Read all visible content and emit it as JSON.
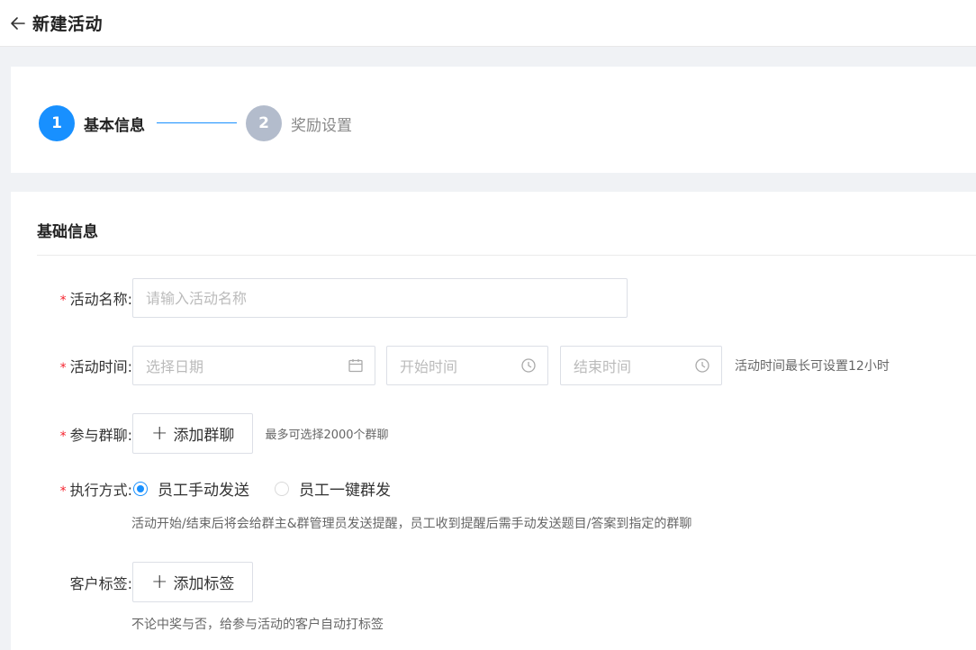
{
  "header": {
    "title": "新建活动"
  },
  "steps": [
    {
      "number": "1",
      "label": "基本信息"
    },
    {
      "number": "2",
      "label": "奖励设置"
    }
  ],
  "form": {
    "section_title": "基础信息",
    "activity_name": {
      "label": "活动名称:",
      "placeholder": "请输入活动名称"
    },
    "activity_time": {
      "label": "活动时间:",
      "date_placeholder": "选择日期",
      "start_placeholder": "开始时间",
      "end_placeholder": "结束时间",
      "hint": "活动时间最长可设置12小时"
    },
    "groups": {
      "label": "参与群聊:",
      "button": "添加群聊",
      "hint": "最多可选择2000个群聊"
    },
    "execution": {
      "label": "执行方式:",
      "options": [
        "员工手动发送",
        "员工一键群发"
      ],
      "selected": "员工手动发送",
      "hint": "活动开始/结束后将会给群主&群管理员发送提醒，员工收到提醒后需手动发送题目/答案到指定的群聊"
    },
    "tags": {
      "label": "客户标签:",
      "button": "添加标签",
      "hint": "不论中奖与否，给参与活动的客户自动打标签"
    }
  },
  "colors": {
    "primary": "#1890ff",
    "required": "#f5222d",
    "step_inactive": "#b3bccc"
  }
}
